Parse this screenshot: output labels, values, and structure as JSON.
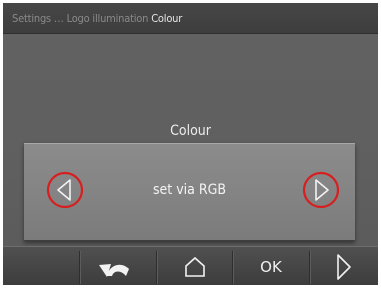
{
  "header": {
    "breadcrumb_path": "Settings … Logo illumination",
    "breadcrumb_current": "Colour"
  },
  "setting": {
    "label": "Colour",
    "value": "set via RGB"
  },
  "footer": {
    "ok_label": "OK"
  },
  "colors": {
    "highlight_circle": "#d81e1e",
    "background": "#5f5f5f"
  },
  "icons": {
    "back": "back-arrow-icon",
    "home": "home-icon",
    "next": "next-chevron-icon",
    "prev_value": "left-triangle-icon",
    "next_value": "right-triangle-icon"
  }
}
